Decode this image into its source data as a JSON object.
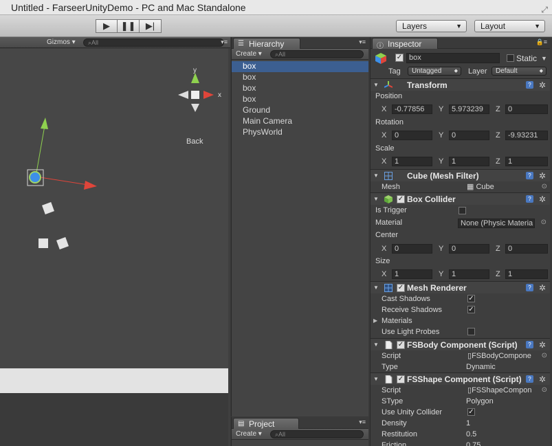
{
  "window": {
    "title": "Untitled - FarseerUnityDemo - PC and Mac Standalone"
  },
  "toolbar": {
    "play_icon": "play-icon",
    "pause_icon": "pause-icon",
    "step_icon": "step-icon",
    "layers_label": "Layers",
    "layout_label": "Layout"
  },
  "scene": {
    "gizmos_label": "Gizmos",
    "search_placeholder": "All",
    "gizmo_y": "y",
    "gizmo_x": "x",
    "view_label": "Back"
  },
  "hierarchy": {
    "tab_label": "Hierarchy",
    "create_label": "Create",
    "search_placeholder": "All",
    "items": [
      "box",
      "box",
      "box",
      "box",
      "Ground",
      "Main Camera",
      "PhysWorld"
    ],
    "selected_index": 0
  },
  "project": {
    "tab_label": "Project",
    "create_label": "Create",
    "search_placeholder": "All"
  },
  "inspector": {
    "tab_label": "Inspector",
    "object_name": "box",
    "static_label": "Static",
    "tag_label": "Tag",
    "tag_value": "Untagged",
    "layer_label": "Layer",
    "layer_value": "Default",
    "transform": {
      "title": "Transform",
      "position_label": "Position",
      "pos_x": "-0.77856",
      "pos_y": "5.973239",
      "pos_z": "0",
      "rotation_label": "Rotation",
      "rot_x": "0",
      "rot_y": "0",
      "rot_z": "-9.93231",
      "scale_label": "Scale",
      "scale_x": "1",
      "scale_y": "1",
      "scale_z": "1"
    },
    "axis": {
      "x": "X",
      "y": "Y",
      "z": "Z"
    },
    "mesh_filter": {
      "title": "Cube (Mesh Filter)",
      "mesh_label": "Mesh",
      "mesh_value": "Cube"
    },
    "box_collider": {
      "title": "Box Collider",
      "is_trigger_label": "Is Trigger",
      "material_label": "Material",
      "material_value": "None (Physic Materia",
      "center_label": "Center",
      "center_x": "0",
      "center_y": "0",
      "center_z": "0",
      "size_label": "Size",
      "size_x": "1",
      "size_y": "1",
      "size_z": "1"
    },
    "mesh_renderer": {
      "title": "Mesh Renderer",
      "cast_shadows_label": "Cast Shadows",
      "receive_shadows_label": "Receive Shadows",
      "materials_label": "Materials",
      "use_light_probes_label": "Use Light Probes"
    },
    "fsbody": {
      "title": "FSBody Component (Script)",
      "script_label": "Script",
      "script_value": "FSBodyCompone",
      "type_label": "Type",
      "type_value": "Dynamic"
    },
    "fsshape": {
      "title": "FSShape Component (Script)",
      "script_label": "Script",
      "script_value": "FSShapeCompon",
      "stype_label": "SType",
      "stype_value": "Polygon",
      "use_unity_collider_label": "Use Unity Collider",
      "density_label": "Density",
      "density_value": "1",
      "restitution_label": "Restitution",
      "restitution_value": "0.5",
      "friction_label": "Friction",
      "friction_value": "0.75"
    }
  },
  "colors": {
    "selection": "#3c5f91",
    "gizmo_y": "#8fd14f",
    "gizmo_x": "#e0453a",
    "panel": "#3e3e3e"
  }
}
